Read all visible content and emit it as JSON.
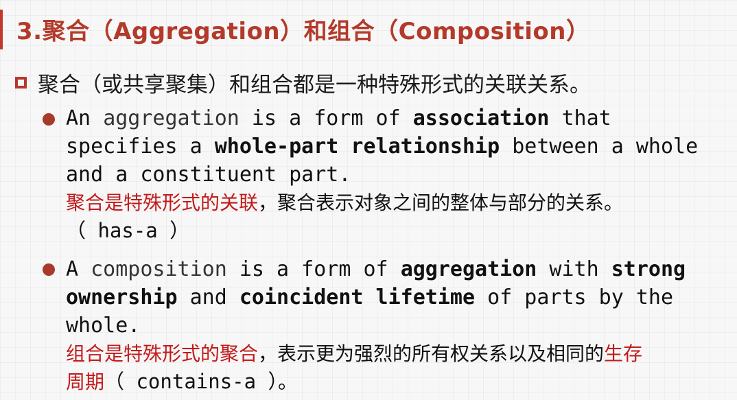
{
  "title": "3.聚合（Aggregation）和组合（Composition）",
  "intro": "聚合（或共享聚集）和组合都是一种特殊形式的关联关系。",
  "aggregation": {
    "line1_a": "An ",
    "line1_b": "aggregation",
    "line1_c": " is a form of ",
    "line1_d": "association",
    "line1_e": " that",
    "line2_a": "specifies a ",
    "line2_b": "whole-part relationship",
    "line2_c": " between a whole",
    "line3": "and a constituent part.",
    "cn_red": "聚合是特殊形式的关联",
    "cn_black": "，聚合表示对象之间的整体与部分的关系。",
    "has_a": "（ has-a ）"
  },
  "composition": {
    "line1_a": "A ",
    "line1_b": "composition",
    "line1_c": " is a form of ",
    "line1_d": "aggregation",
    "line1_e": " with ",
    "line1_f": "strong",
    "line2_a": "ownership",
    "line2_b": " and ",
    "line2_c": "coincident lifetime",
    "line2_d": " of parts by the",
    "line3": "whole.",
    "cn_red": "组合是特殊形式的聚合",
    "cn_black": "，表示更为强烈的所有权关系以及相同的",
    "cn_red2": "生存",
    "cn_red3": "周期",
    "contains_a": "（ contains-a ）。"
  },
  "colors": {
    "accent": "#b33a2a",
    "red_text": "#c21a1a"
  }
}
